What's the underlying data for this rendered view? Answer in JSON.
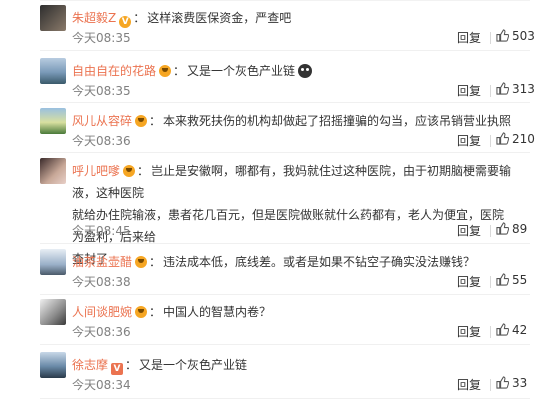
{
  "comments": [
    {
      "user": "朱超毅Z",
      "badge": "vip",
      "sep": "：",
      "text": "这样滚费医保资金，严查吧",
      "time": "今天08:35",
      "reply": "回复",
      "likes": "503",
      "avatar_colors": [
        "#3c3c3c",
        "#7a6a5a"
      ]
    },
    {
      "user": "自由自在的花路",
      "badge": "emoji",
      "sep": "：",
      "text": "又是一个灰色产业链",
      "time": "今天08:35",
      "reply": "回复",
      "likes": "313",
      "avatar_colors": [
        "#6a8aa8",
        "#c8d8e8"
      ]
    },
    {
      "user": "风儿从容碎",
      "badge": "emoji",
      "sep": "：",
      "text": "本来救死扶伤的机构却做起了招摇撞骗的勾当，应该吊销营业执照",
      "time": "今天08:36",
      "reply": "回复",
      "likes": "210",
      "avatar_colors": [
        "#4a7a3a",
        "#e8d8a8"
      ]
    },
    {
      "user": "呼儿吧嗲",
      "badge": "emoji",
      "sep": "：",
      "text_lines": [
        "岂止是安徽啊，哪都有，我妈就住过这种医院，由于初期脑梗需要输液，这种医院",
        "就给办住院输液，患者花几百元，但是医院做账就什么药都有，老人为便宜，医院为盈利，后来给",
        "查封了"
      ],
      "time": "今天08:45",
      "reply": "回复",
      "likes": "89",
      "avatar_colors": [
        "#5a3a2a",
        "#c8a898"
      ]
    },
    {
      "user": "油茶盐壶醋",
      "badge": "emoji",
      "sep": "：",
      "text": "违法成本低，底线差。或者是如果不钻空子确实没法赚钱？",
      "time": "今天08:38",
      "reply": "回复",
      "likes": "55",
      "avatar_colors": [
        "#8aa8c8",
        "#dde8f0"
      ]
    },
    {
      "user": "人间谈肥婉",
      "badge": "emoji",
      "sep": "：",
      "text": "中国人的智慧内卷？",
      "time": "今天08:36",
      "reply": "回复",
      "likes": "42",
      "avatar_colors": [
        "#5a5a5a",
        "#d8d8d8"
      ]
    },
    {
      "user": "徐志摩",
      "badge": "vip",
      "sep": "：",
      "text": "又是一个灰色产业链",
      "time": "今天08:34",
      "reply": "回复",
      "likes": "33",
      "avatar_colors": [
        "#3a5a7a",
        "#a8c8e8"
      ]
    }
  ]
}
